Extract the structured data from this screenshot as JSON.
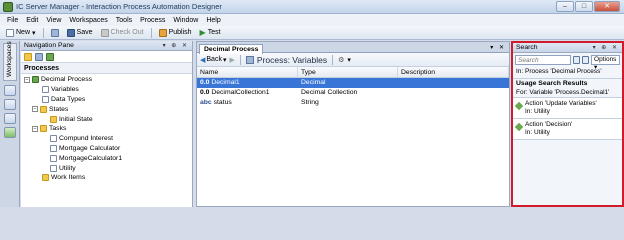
{
  "window": {
    "title": "IC Server Manager - Interaction Process Automation Designer"
  },
  "menu": [
    "File",
    "Edit",
    "View",
    "Workspaces",
    "Tools",
    "Process",
    "Window",
    "Help"
  ],
  "toolbar": {
    "new": "New",
    "save": "Save",
    "checkout": "Check Out",
    "publish": "Publish",
    "test": "Test"
  },
  "sidebar": {
    "tab": "Workspaces"
  },
  "nav": {
    "title": "Navigation Pane",
    "section": "Processes",
    "tree": {
      "root": "Decimal Process",
      "variables": "Variables",
      "datatypes": "Data Types",
      "states": "States",
      "initial_state": "Initial State",
      "tasks": "Tasks",
      "task1": "Compund Interest",
      "task2": "Mortgage Calculator",
      "task3": "MortgageCalculator1",
      "task4": "Utility",
      "workitems": "Work Items"
    }
  },
  "editor": {
    "tab": "Decimal Process",
    "back": "Back",
    "crumb": "Process: Variables",
    "columns": {
      "name": "Name",
      "type": "Type",
      "description": "Description"
    },
    "rows": [
      {
        "icon": "0.0",
        "name": "Decimal1",
        "type": "Decimal",
        "selected": true
      },
      {
        "icon": "0.0",
        "name": "DecimalCollection1",
        "type": "Decimal Collection",
        "selected": false
      },
      {
        "icon": "abc",
        "name": "status",
        "type": "String",
        "selected": false
      }
    ]
  },
  "search": {
    "title": "Search",
    "placeholder": "Search",
    "options": "Options",
    "scope": "In: Process 'Decimal Process'",
    "results_title": "Usage Search Results",
    "for": "For: Variable 'Process.Decimal1'",
    "results": [
      {
        "line1": "Action 'Update Variables'",
        "line2": "In: Utility"
      },
      {
        "line1": "Action 'Decision'",
        "line2": "In: Utility"
      }
    ]
  },
  "colors": {
    "highlight": "#d11a2a",
    "selection": "#3875d7"
  }
}
